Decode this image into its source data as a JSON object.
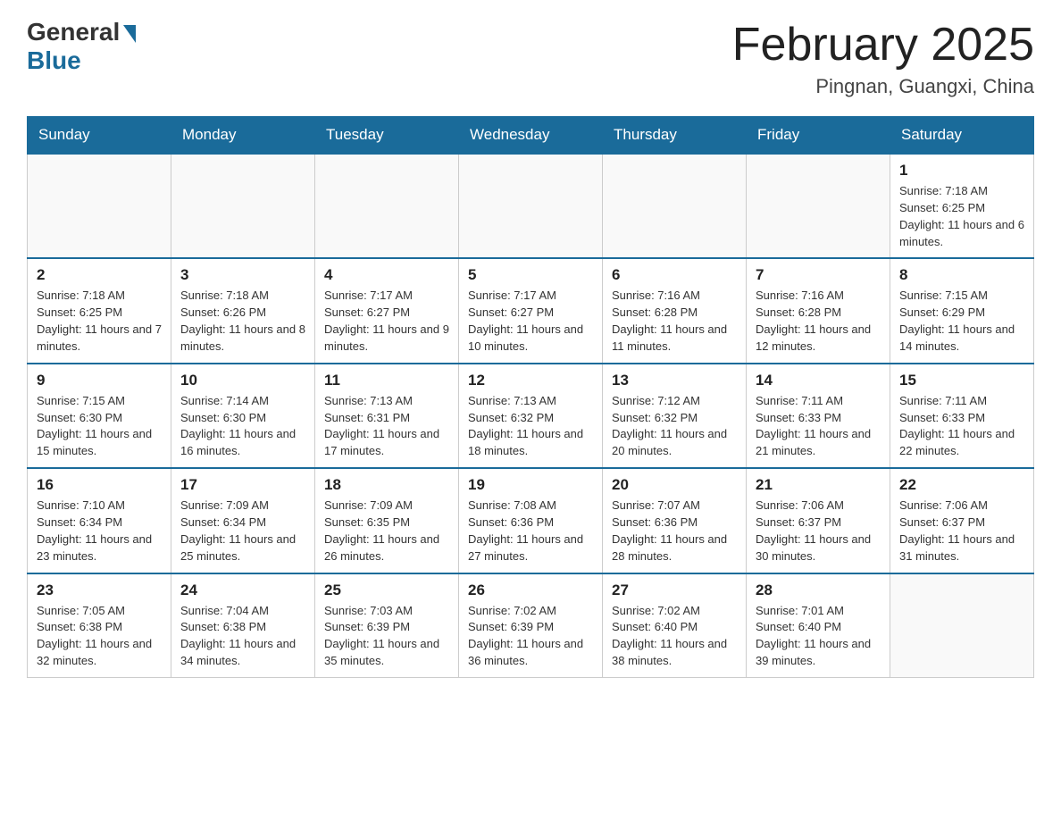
{
  "header": {
    "logo_general": "General",
    "logo_blue": "Blue",
    "month_title": "February 2025",
    "location": "Pingnan, Guangxi, China"
  },
  "weekdays": [
    "Sunday",
    "Monday",
    "Tuesday",
    "Wednesday",
    "Thursday",
    "Friday",
    "Saturday"
  ],
  "weeks": [
    [
      {
        "day": "",
        "sunrise": "",
        "sunset": "",
        "daylight": ""
      },
      {
        "day": "",
        "sunrise": "",
        "sunset": "",
        "daylight": ""
      },
      {
        "day": "",
        "sunrise": "",
        "sunset": "",
        "daylight": ""
      },
      {
        "day": "",
        "sunrise": "",
        "sunset": "",
        "daylight": ""
      },
      {
        "day": "",
        "sunrise": "",
        "sunset": "",
        "daylight": ""
      },
      {
        "day": "",
        "sunrise": "",
        "sunset": "",
        "daylight": ""
      },
      {
        "day": "1",
        "sunrise": "Sunrise: 7:18 AM",
        "sunset": "Sunset: 6:25 PM",
        "daylight": "Daylight: 11 hours and 6 minutes."
      }
    ],
    [
      {
        "day": "2",
        "sunrise": "Sunrise: 7:18 AM",
        "sunset": "Sunset: 6:25 PM",
        "daylight": "Daylight: 11 hours and 7 minutes."
      },
      {
        "day": "3",
        "sunrise": "Sunrise: 7:18 AM",
        "sunset": "Sunset: 6:26 PM",
        "daylight": "Daylight: 11 hours and 8 minutes."
      },
      {
        "day": "4",
        "sunrise": "Sunrise: 7:17 AM",
        "sunset": "Sunset: 6:27 PM",
        "daylight": "Daylight: 11 hours and 9 minutes."
      },
      {
        "day": "5",
        "sunrise": "Sunrise: 7:17 AM",
        "sunset": "Sunset: 6:27 PM",
        "daylight": "Daylight: 11 hours and 10 minutes."
      },
      {
        "day": "6",
        "sunrise": "Sunrise: 7:16 AM",
        "sunset": "Sunset: 6:28 PM",
        "daylight": "Daylight: 11 hours and 11 minutes."
      },
      {
        "day": "7",
        "sunrise": "Sunrise: 7:16 AM",
        "sunset": "Sunset: 6:28 PM",
        "daylight": "Daylight: 11 hours and 12 minutes."
      },
      {
        "day": "8",
        "sunrise": "Sunrise: 7:15 AM",
        "sunset": "Sunset: 6:29 PM",
        "daylight": "Daylight: 11 hours and 14 minutes."
      }
    ],
    [
      {
        "day": "9",
        "sunrise": "Sunrise: 7:15 AM",
        "sunset": "Sunset: 6:30 PM",
        "daylight": "Daylight: 11 hours and 15 minutes."
      },
      {
        "day": "10",
        "sunrise": "Sunrise: 7:14 AM",
        "sunset": "Sunset: 6:30 PM",
        "daylight": "Daylight: 11 hours and 16 minutes."
      },
      {
        "day": "11",
        "sunrise": "Sunrise: 7:13 AM",
        "sunset": "Sunset: 6:31 PM",
        "daylight": "Daylight: 11 hours and 17 minutes."
      },
      {
        "day": "12",
        "sunrise": "Sunrise: 7:13 AM",
        "sunset": "Sunset: 6:32 PM",
        "daylight": "Daylight: 11 hours and 18 minutes."
      },
      {
        "day": "13",
        "sunrise": "Sunrise: 7:12 AM",
        "sunset": "Sunset: 6:32 PM",
        "daylight": "Daylight: 11 hours and 20 minutes."
      },
      {
        "day": "14",
        "sunrise": "Sunrise: 7:11 AM",
        "sunset": "Sunset: 6:33 PM",
        "daylight": "Daylight: 11 hours and 21 minutes."
      },
      {
        "day": "15",
        "sunrise": "Sunrise: 7:11 AM",
        "sunset": "Sunset: 6:33 PM",
        "daylight": "Daylight: 11 hours and 22 minutes."
      }
    ],
    [
      {
        "day": "16",
        "sunrise": "Sunrise: 7:10 AM",
        "sunset": "Sunset: 6:34 PM",
        "daylight": "Daylight: 11 hours and 23 minutes."
      },
      {
        "day": "17",
        "sunrise": "Sunrise: 7:09 AM",
        "sunset": "Sunset: 6:34 PM",
        "daylight": "Daylight: 11 hours and 25 minutes."
      },
      {
        "day": "18",
        "sunrise": "Sunrise: 7:09 AM",
        "sunset": "Sunset: 6:35 PM",
        "daylight": "Daylight: 11 hours and 26 minutes."
      },
      {
        "day": "19",
        "sunrise": "Sunrise: 7:08 AM",
        "sunset": "Sunset: 6:36 PM",
        "daylight": "Daylight: 11 hours and 27 minutes."
      },
      {
        "day": "20",
        "sunrise": "Sunrise: 7:07 AM",
        "sunset": "Sunset: 6:36 PM",
        "daylight": "Daylight: 11 hours and 28 minutes."
      },
      {
        "day": "21",
        "sunrise": "Sunrise: 7:06 AM",
        "sunset": "Sunset: 6:37 PM",
        "daylight": "Daylight: 11 hours and 30 minutes."
      },
      {
        "day": "22",
        "sunrise": "Sunrise: 7:06 AM",
        "sunset": "Sunset: 6:37 PM",
        "daylight": "Daylight: 11 hours and 31 minutes."
      }
    ],
    [
      {
        "day": "23",
        "sunrise": "Sunrise: 7:05 AM",
        "sunset": "Sunset: 6:38 PM",
        "daylight": "Daylight: 11 hours and 32 minutes."
      },
      {
        "day": "24",
        "sunrise": "Sunrise: 7:04 AM",
        "sunset": "Sunset: 6:38 PM",
        "daylight": "Daylight: 11 hours and 34 minutes."
      },
      {
        "day": "25",
        "sunrise": "Sunrise: 7:03 AM",
        "sunset": "Sunset: 6:39 PM",
        "daylight": "Daylight: 11 hours and 35 minutes."
      },
      {
        "day": "26",
        "sunrise": "Sunrise: 7:02 AM",
        "sunset": "Sunset: 6:39 PM",
        "daylight": "Daylight: 11 hours and 36 minutes."
      },
      {
        "day": "27",
        "sunrise": "Sunrise: 7:02 AM",
        "sunset": "Sunset: 6:40 PM",
        "daylight": "Daylight: 11 hours and 38 minutes."
      },
      {
        "day": "28",
        "sunrise": "Sunrise: 7:01 AM",
        "sunset": "Sunset: 6:40 PM",
        "daylight": "Daylight: 11 hours and 39 minutes."
      },
      {
        "day": "",
        "sunrise": "",
        "sunset": "",
        "daylight": ""
      }
    ]
  ]
}
